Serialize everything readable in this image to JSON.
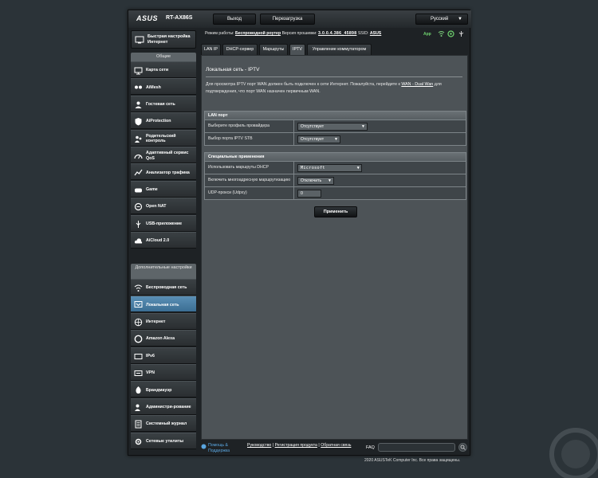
{
  "header": {
    "brand": "ASUS",
    "model": "RT-AX86S",
    "logout": "Выход",
    "reboot": "Перезагрузка",
    "language": "Русский"
  },
  "status": {
    "mode_label": "Режим работы:",
    "mode_value": "Беспроводной роутер",
    "fw_label": "Версия прошивки:",
    "fw_value": "3.0.0.4.386_45898",
    "ssid_label": "SSID:",
    "ssid_value": "ASUS",
    "app": "App"
  },
  "sidebar": {
    "quick": "Быстрая настройка Интернет",
    "general_head": "Общие",
    "general": [
      {
        "label": "Карта сети",
        "icon": "network-map-icon"
      },
      {
        "label": "AiMesh",
        "icon": "aimesh-icon"
      },
      {
        "label": "Гостевая сеть",
        "icon": "guest-network-icon"
      },
      {
        "label": "AiProtection",
        "icon": "shield-icon"
      },
      {
        "label": "Родительский контроль",
        "icon": "parental-control-icon"
      },
      {
        "label": "Адаптивный сервис QoS",
        "icon": "qos-icon"
      },
      {
        "label": "Анализатор трафика",
        "icon": "traffic-analyzer-icon"
      },
      {
        "label": "Game",
        "icon": "gamepad-icon"
      },
      {
        "label": "Open NAT",
        "icon": "open-nat-icon"
      },
      {
        "label": "USB-приложение",
        "icon": "usb-icon"
      },
      {
        "label": "AiCloud 2.0",
        "icon": "cloud-icon"
      }
    ],
    "advanced_head": "Дополнительные настройки",
    "advanced": [
      {
        "label": "Беспроводная сеть",
        "icon": "wireless-icon"
      },
      {
        "label": "Локальная сеть",
        "icon": "lan-icon"
      },
      {
        "label": "Интернет",
        "icon": "globe-icon"
      },
      {
        "label": "Amazon Alexa",
        "icon": "alexa-icon"
      },
      {
        "label": "IPv6",
        "icon": "ipv6-icon"
      },
      {
        "label": "VPN",
        "icon": "vpn-icon"
      },
      {
        "label": "Брандмауэр",
        "icon": "firewall-icon"
      },
      {
        "label": "Администри-рование",
        "icon": "admin-icon"
      },
      {
        "label": "Системный журнал",
        "icon": "system-log-icon"
      },
      {
        "label": "Сетевые утилиты",
        "icon": "network-tools-icon"
      }
    ],
    "active_index": 1
  },
  "tabs": [
    "LAN IP",
    "DHCP-сервер",
    "Маршруты",
    "IPTV",
    "Управление коммутатором"
  ],
  "active_tab": 3,
  "page": {
    "title": "Локальная сеть - IPTV",
    "desc_part1": "Для просмотра IPTV порт WAN должен быть подключен к сети Интернет. Пожалуйста, перейдите к ",
    "desc_link": "WAN - Dual Wan",
    "desc_part2": " для подтверждения, что порт WAN назначен первичным WAN."
  },
  "lan_port": {
    "header": "LAN порт",
    "rows": [
      {
        "label": "Выберите профиль провайдера",
        "value": "Отсутствует"
      },
      {
        "label": "Выбор порта IPTV STB",
        "value": "Отсутствует"
      }
    ]
  },
  "special": {
    "header": "Специальные применения",
    "rows": [
      {
        "label": "Использовать маршруты DHCP",
        "value": "Microsoft"
      },
      {
        "label": "Включить многоадресную маршрутизацию",
        "value": "Отключить"
      },
      {
        "label": "UDP-прокси (Udpxy)",
        "value": "0"
      }
    ]
  },
  "apply": "Применить",
  "footer": {
    "help": "Помощь & Поддержка",
    "manual": "Руководство",
    "register": "Регистрация продукта",
    "feedback": "Обратная связь",
    "faq": "FAQ",
    "copyright": "2020 ASUSTeK Computer Inc. Все права защищены."
  },
  "colors": {
    "accent_active": "#3b6e93",
    "panel": "#4d5357",
    "background": "#2b3338"
  }
}
